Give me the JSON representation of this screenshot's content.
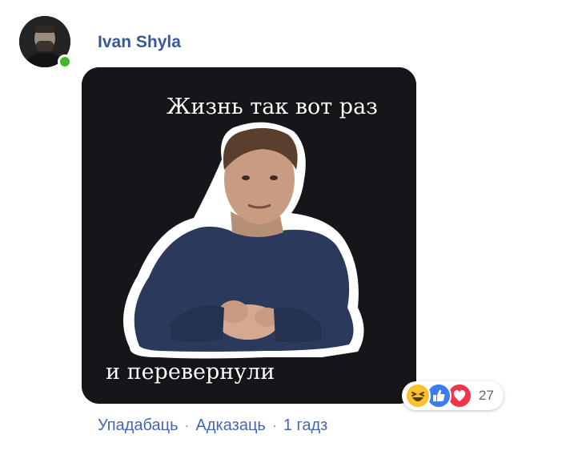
{
  "comment": {
    "author": "Ivan Shyla",
    "sticker": {
      "caption_top": "Жизнь так вот раз",
      "caption_bottom": "и перевернули"
    },
    "reactions": {
      "icons": [
        "haha-icon",
        "like-icon",
        "love-icon"
      ],
      "count": "27"
    },
    "actions": {
      "like": "Упадабаць",
      "reply": "Адказаць",
      "separator": "·",
      "time": "1 гадз"
    },
    "colors": {
      "author": "#385898",
      "link": "#4267b2",
      "online": "#42b72a",
      "sticker_bg": "#15151a"
    }
  }
}
